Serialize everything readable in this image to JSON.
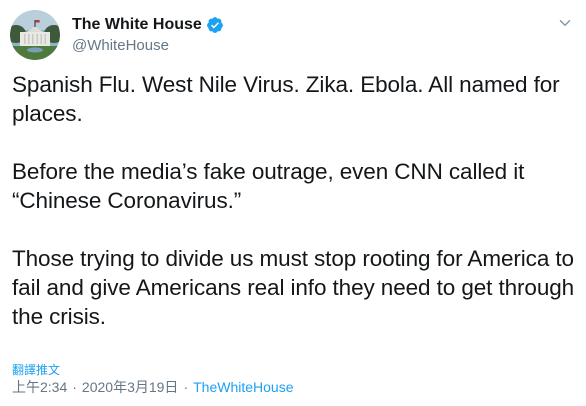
{
  "author": {
    "display_name": "The White House",
    "handle": "@WhiteHouse",
    "verified": true
  },
  "tweet": {
    "paragraphs": [
      "Spanish Flu. West Nile Virus. Zika. Ebola. All named for places.",
      "Before the media’s fake outrage, even CNN called it “Chinese Coronavirus.”",
      "Those trying to divide us must stop rooting for America to fail and give Americans real info they need to get through the crisis."
    ]
  },
  "translate_label": "翻譯推文",
  "meta": {
    "time": "上午2:34",
    "separator": "·",
    "date": "2020年3月19日",
    "source": "TheWhiteHouse"
  },
  "icons": {
    "verified": "verified-badge-icon",
    "menu": "chevron-down-icon"
  },
  "colors": {
    "link": "#1da1f2",
    "secondary": "#657786",
    "text": "#14171a"
  }
}
